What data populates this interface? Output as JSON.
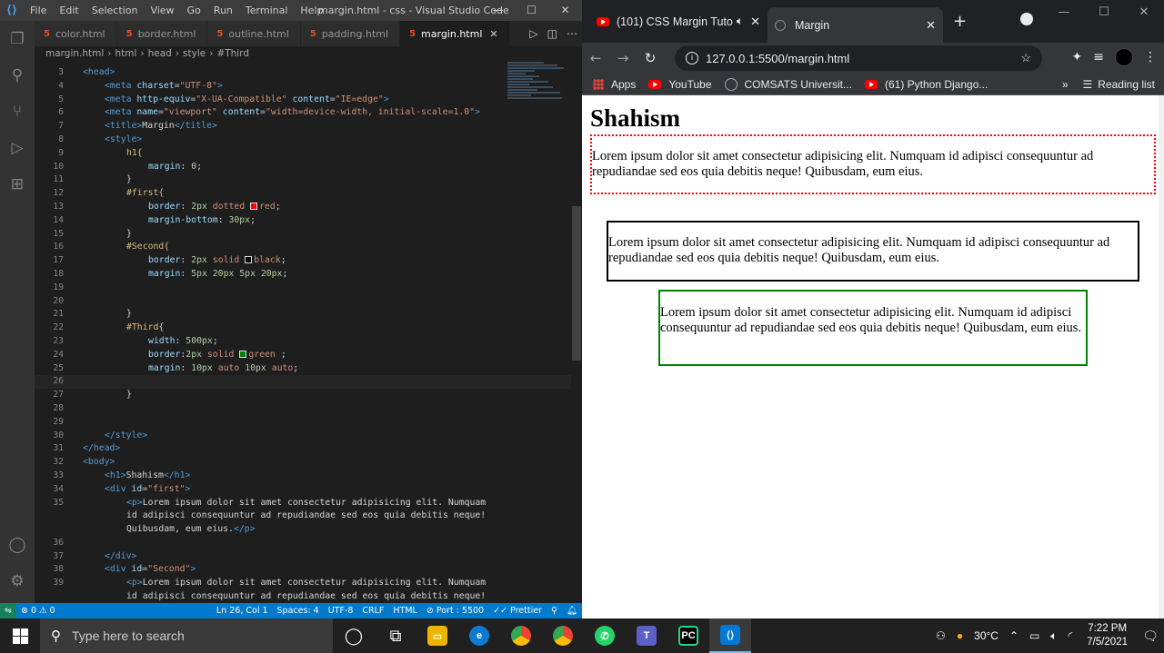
{
  "vscode": {
    "menu": [
      "File",
      "Edit",
      "Selection",
      "View",
      "Go",
      "Run",
      "Terminal",
      "Help"
    ],
    "window_title": "margin.html - css - Visual Studio Code",
    "tabs": [
      {
        "label": "color.html"
      },
      {
        "label": "border.html"
      },
      {
        "label": "outline.html"
      },
      {
        "label": "padding.html"
      },
      {
        "label": "margin.html"
      }
    ],
    "breadcrumb": [
      "margin.html",
      "html",
      "head",
      "style",
      "#Third"
    ],
    "code_lines": [
      {
        "n": "3",
        "html": "<span class='t-tag'>&lt;head&gt;</span>",
        "indent": 0
      },
      {
        "n": "4",
        "html": "<span class='t-tag'>&lt;meta</span> <span class='t-attr'>charset</span>=<span class='t-str'>\"UTF-8\"</span><span class='t-tag'>&gt;</span>",
        "indent": 1
      },
      {
        "n": "5",
        "html": "<span class='t-tag'>&lt;meta</span> <span class='t-attr'>http-equiv</span>=<span class='t-str'>\"X-UA-Compatible\"</span> <span class='t-attr'>content</span>=<span class='t-str'>\"IE=edge\"</span><span class='t-tag'>&gt;</span>",
        "indent": 1
      },
      {
        "n": "6",
        "html": "<span class='t-tag'>&lt;meta</span> <span class='t-attr'>name</span>=<span class='t-str'>\"viewport\"</span> <span class='t-attr'>content</span>=<span class='t-str'>\"width=device-width, initial-scale=1.0\"</span><span class='t-tag'>&gt;</span>",
        "indent": 1
      },
      {
        "n": "7",
        "html": "<span class='t-tag'>&lt;title&gt;</span><span class='t-text'>Margin</span><span class='t-tag'>&lt;/title&gt;</span>",
        "indent": 1
      },
      {
        "n": "8",
        "html": "<span class='t-tag'>&lt;style&gt;</span>",
        "indent": 1
      },
      {
        "n": "9",
        "html": "<span class='t-sel'>h1{</span>",
        "indent": 2
      },
      {
        "n": "10",
        "html": "<span class='t-prop'>margin</span><span class='t-text'>: </span><span class='t-num'>0</span><span class='t-text'>;</span>",
        "indent": 3
      },
      {
        "n": "11",
        "html": "<span class='t-text'>}</span>",
        "indent": 2
      },
      {
        "n": "12",
        "html": "<span class='t-sel'>#first{</span>",
        "indent": 2
      },
      {
        "n": "13",
        "html": "<span class='t-prop'>border</span><span class='t-text'>: </span><span class='t-num'>2px</span> <span class='t-val'>dotted</span> <span class='sw' style='background:red'></span><span class='t-val'>red</span><span class='t-text'>;</span>",
        "indent": 3
      },
      {
        "n": "14",
        "html": "<span class='t-prop'>margin-bottom</span><span class='t-text'>: </span><span class='t-num'>30px</span><span class='t-text'>;</span>",
        "indent": 3
      },
      {
        "n": "15",
        "html": "<span class='t-text'>}</span>",
        "indent": 2
      },
      {
        "n": "16",
        "html": "<span class='t-sel'>#Second{</span>",
        "indent": 2
      },
      {
        "n": "17",
        "html": "<span class='t-prop'>border</span><span class='t-text'>: </span><span class='t-num'>2px</span> <span class='t-val'>solid</span> <span class='sw' style='background:black'></span><span class='t-val'>black</span><span class='t-text'>;</span>",
        "indent": 3
      },
      {
        "n": "18",
        "html": "<span class='t-prop'>margin</span><span class='t-text'>: </span><span class='t-num'>5px 20px 5px 20px</span><span class='t-text'>;</span>",
        "indent": 3
      },
      {
        "n": "19",
        "html": "",
        "indent": 0
      },
      {
        "n": "20",
        "html": "",
        "indent": 0
      },
      {
        "n": "21",
        "html": "<span class='t-text'>}</span>",
        "indent": 2
      },
      {
        "n": "22",
        "html": "<span class='t-sel'>#Third</span><span class='t-text'>{</span>",
        "indent": 2
      },
      {
        "n": "23",
        "html": "<span class='t-prop'>width</span><span class='t-text'>: </span><span class='t-num'>500px</span><span class='t-text'>;</span>",
        "indent": 3
      },
      {
        "n": "24",
        "html": "<span class='t-prop'>border</span><span class='t-text'>:</span><span class='t-num'>2px</span> <span class='t-val'>solid</span> <span class='sw' style='background:green'></span><span class='t-val'>green</span> <span class='t-text'>;</span>",
        "indent": 3
      },
      {
        "n": "25",
        "html": "<span class='t-prop'>margin</span><span class='t-text'>: </span><span class='t-num'>10px</span> <span class='t-val'>auto</span> <span class='t-num'>10px</span> <span class='t-val'>auto</span><span class='t-text'>;</span>",
        "indent": 3
      },
      {
        "n": "26",
        "html": "",
        "indent": 0
      },
      {
        "n": "27",
        "html": "<span class='t-text'>}</span>",
        "indent": 2
      },
      {
        "n": "28",
        "html": "",
        "indent": 0
      },
      {
        "n": "29",
        "html": "",
        "indent": 0
      },
      {
        "n": "30",
        "html": "<span class='t-tag'>&lt;/style&gt;</span>",
        "indent": 1
      },
      {
        "n": "31",
        "html": "<span class='t-tag'>&lt;/head&gt;</span>",
        "indent": 0
      },
      {
        "n": "32",
        "html": "<span class='t-tag'>&lt;body&gt;</span>",
        "indent": 0
      },
      {
        "n": "33",
        "html": "<span class='t-tag'>&lt;h1&gt;</span><span class='t-text'>Shahism</span><span class='t-tag'>&lt;/h1&gt;</span>",
        "indent": 1
      },
      {
        "n": "34",
        "html": "<span class='t-tag'>&lt;div</span> <span class='t-attr'>id</span>=<span class='t-str'>\"first\"</span><span class='t-tag'>&gt;</span>",
        "indent": 1
      },
      {
        "n": "35",
        "html": "<span class='t-tag'>&lt;p&gt;</span><span class='t-text'>Lorem ipsum dolor sit amet consectetur adipisicing elit. Numquam</span>",
        "indent": 2
      },
      {
        "n": "",
        "html": "<span class='t-text'>id adipisci consequuntur ad repudiandae sed eos quia debitis neque!</span>",
        "indent": 2
      },
      {
        "n": "",
        "html": "<span class='t-text'>Quibusdam, eum eius.</span><span class='t-tag'>&lt;/p&gt;</span>",
        "indent": 2
      },
      {
        "n": "36",
        "html": "",
        "indent": 0
      },
      {
        "n": "37",
        "html": "<span class='t-tag'>&lt;/div&gt;</span>",
        "indent": 1
      },
      {
        "n": "38",
        "html": "<span class='t-tag'>&lt;div</span> <span class='t-attr'>id</span>=<span class='t-str'>\"Second\"</span><span class='t-tag'>&gt;</span>",
        "indent": 1
      },
      {
        "n": "39",
        "html": "<span class='t-tag'>&lt;p&gt;</span><span class='t-text'>Lorem ipsum dolor sit amet consectetur adipisicing elit. Numquam</span>",
        "indent": 2
      },
      {
        "n": "",
        "html": "<span class='t-text'>id adipisci consequuntur ad repudiandae sed eos quia debitis neque!</span>",
        "indent": 2
      }
    ],
    "status": {
      "errors": "⊗ 0 ⚠ 0",
      "position": "Ln 26, Col 1",
      "spaces": "Spaces: 4",
      "encoding": "UTF-8",
      "eol": "CRLF",
      "language": "HTML",
      "port": "⊘ Port : 5500",
      "prettier": "✓✓ Prettier"
    }
  },
  "chrome": {
    "tabs": [
      {
        "label": "(101) CSS Margin Tuto"
      },
      {
        "label": "Margin"
      }
    ],
    "url": "127.0.0.1:5500/margin.html",
    "bookmarks": [
      "Apps",
      "YouTube",
      "COMSATS Universit...",
      "(61) Python Django..."
    ],
    "reading_list": "Reading list",
    "page": {
      "heading": "Shahism",
      "para1": "Lorem ipsum dolor sit amet consectetur adipisicing elit. Numquam id adipisci consequuntur ad repudiandae sed eos quia debitis neque! Quibusdam, eum eius.",
      "para2": "Lorem ipsum dolor sit amet consectetur adipisicing elit. Numquam id adipisci consequuntur ad repudiandae sed eos quia debitis neque! Quibusdam, eum eius.",
      "para3": "Lorem ipsum dolor sit amet consectetur adipisicing elit. Numquam id adipisci consequuntur ad repudiandae sed eos quia debitis neque! Quibusdam, eum eius."
    }
  },
  "taskbar": {
    "search_placeholder": "Type here to search",
    "temperature": "30°C",
    "time": "7:22 PM",
    "date": "7/5/2021"
  }
}
